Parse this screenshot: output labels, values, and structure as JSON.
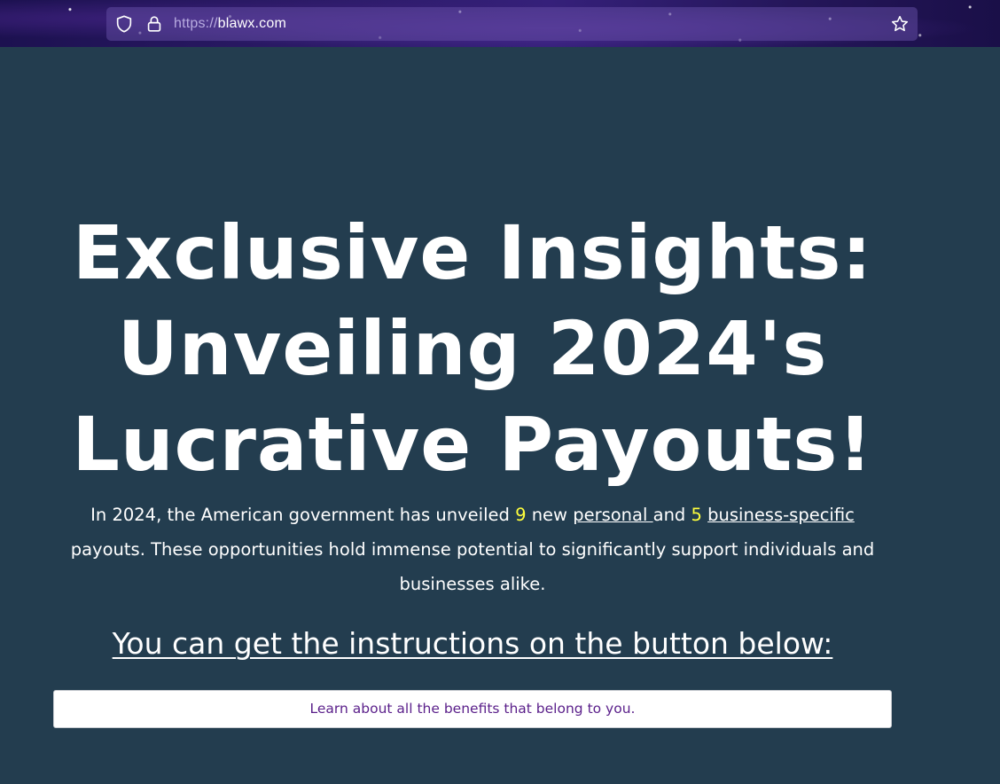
{
  "browser": {
    "url_scheme": "https://",
    "url_host": "blawx.com",
    "icons": [
      "shield-icon",
      "lock-icon",
      "star-bookmark-icon"
    ]
  },
  "page": {
    "headline": "Exclusive Insights: Unveiling 2024's Lucrative Payouts!",
    "intro": {
      "part1": "In 2024, the American government has unveiled ",
      "count_personal": "9",
      "part2": " new ",
      "link_personal": "personal ",
      "part3": "and ",
      "count_business": "5",
      "part4": " ",
      "link_business": "business-specific",
      "part5": " payouts. These opportunities hold immense potential to significantly support individuals and businesses alike."
    },
    "instructions": "You can get the instructions on the button below:",
    "cta_label": "Learn about all the benefits that belong to you."
  },
  "colors": {
    "background": "#233d4f",
    "highlight": "#ffff3c",
    "button_text": "#5a1f8a",
    "browser_bar": "#2b1a66"
  }
}
